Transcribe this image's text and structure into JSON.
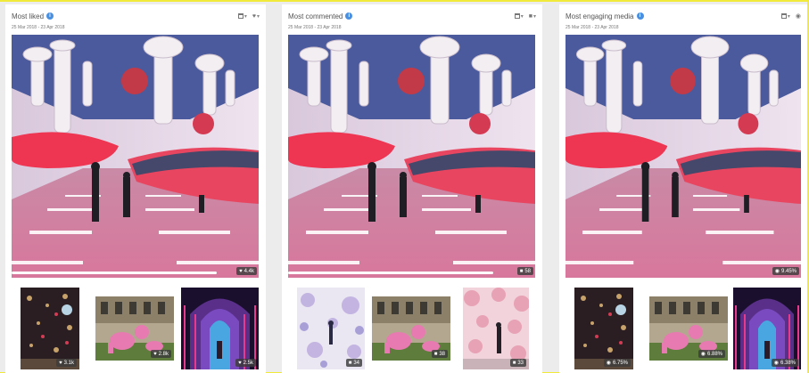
{
  "colors": {
    "accent": "#4a90e2",
    "frame": "#f2ea3a",
    "badge_bg": "#3c3c3c"
  },
  "panels": [
    {
      "title": "Most liked",
      "date_range": "25 Mar 2018 - 23 Apr 2018",
      "metric_icon": "heart-icon",
      "hero_badge": "4.4k",
      "thumbs": [
        {
          "scene": "dark-installation",
          "badge": "3.1k",
          "icon": "heart-icon"
        },
        {
          "scene": "pink-sculpture-courtyard",
          "badge": "2.8k",
          "icon": "heart-icon"
        },
        {
          "scene": "neon-corridor",
          "badge": "2.5k",
          "icon": "heart-icon"
        }
      ]
    },
    {
      "title": "Most commented",
      "date_range": "25 Mar 2018 - 23 Apr 2018",
      "metric_icon": "comment-icon",
      "hero_badge": "58",
      "thumbs": [
        {
          "scene": "frosted-figure",
          "badge": "34",
          "icon": "comment-icon"
        },
        {
          "scene": "pink-sculpture-courtyard",
          "badge": "38",
          "icon": "comment-icon"
        },
        {
          "scene": "pink-blossom-figure",
          "badge": "33",
          "icon": "comment-icon"
        }
      ]
    },
    {
      "title": "Most engaging media",
      "date_range": "25 Mar 2018 - 23 Apr 2018",
      "metric_icon": "engagement-icon",
      "hero_badge": "9.45%",
      "thumbs": [
        {
          "scene": "dark-installation",
          "badge": "6.75%",
          "icon": "engagement-icon"
        },
        {
          "scene": "pink-sculpture-courtyard",
          "badge": "6.88%",
          "icon": "engagement-icon"
        },
        {
          "scene": "neon-corridor",
          "badge": "6.38%",
          "icon": "engagement-icon"
        }
      ]
    }
  ]
}
